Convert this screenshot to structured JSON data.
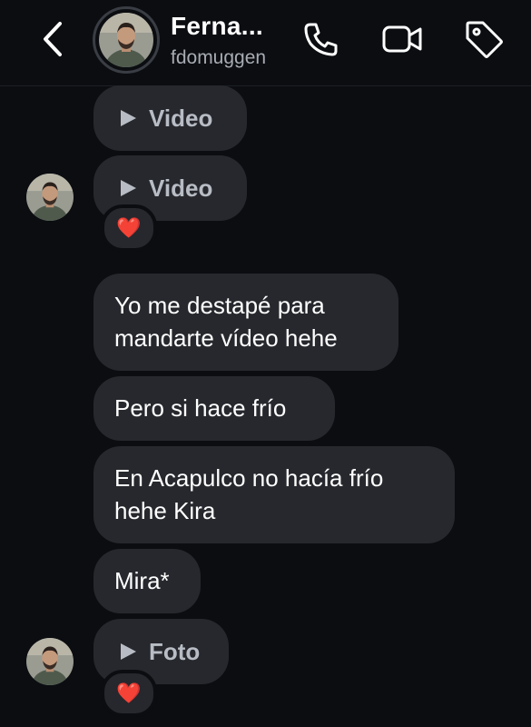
{
  "header": {
    "contact_name": "Ferna...",
    "username": "fdomuggen"
  },
  "messages": {
    "video1_label": "Video",
    "video2_label": "Video",
    "reaction1": "❤️",
    "text1": "Yo me destapé para mandarte vídeo hehe",
    "text2": "Pero si hace frío",
    "text3": "En Acapulco no hacía frío hehe Kira",
    "text4": "Mira*",
    "photo_label": "Foto",
    "reaction2": "❤️"
  },
  "colors": {
    "background": "#0b0d11",
    "bubble": "#26282d",
    "media_label": "#b8bcc4",
    "secondary_text": "#a8acb3"
  },
  "icons": {
    "back": "chevron-left-icon",
    "call": "phone-icon",
    "video_call": "video-camera-icon",
    "tag": "tag-icon",
    "play": "play-icon"
  }
}
